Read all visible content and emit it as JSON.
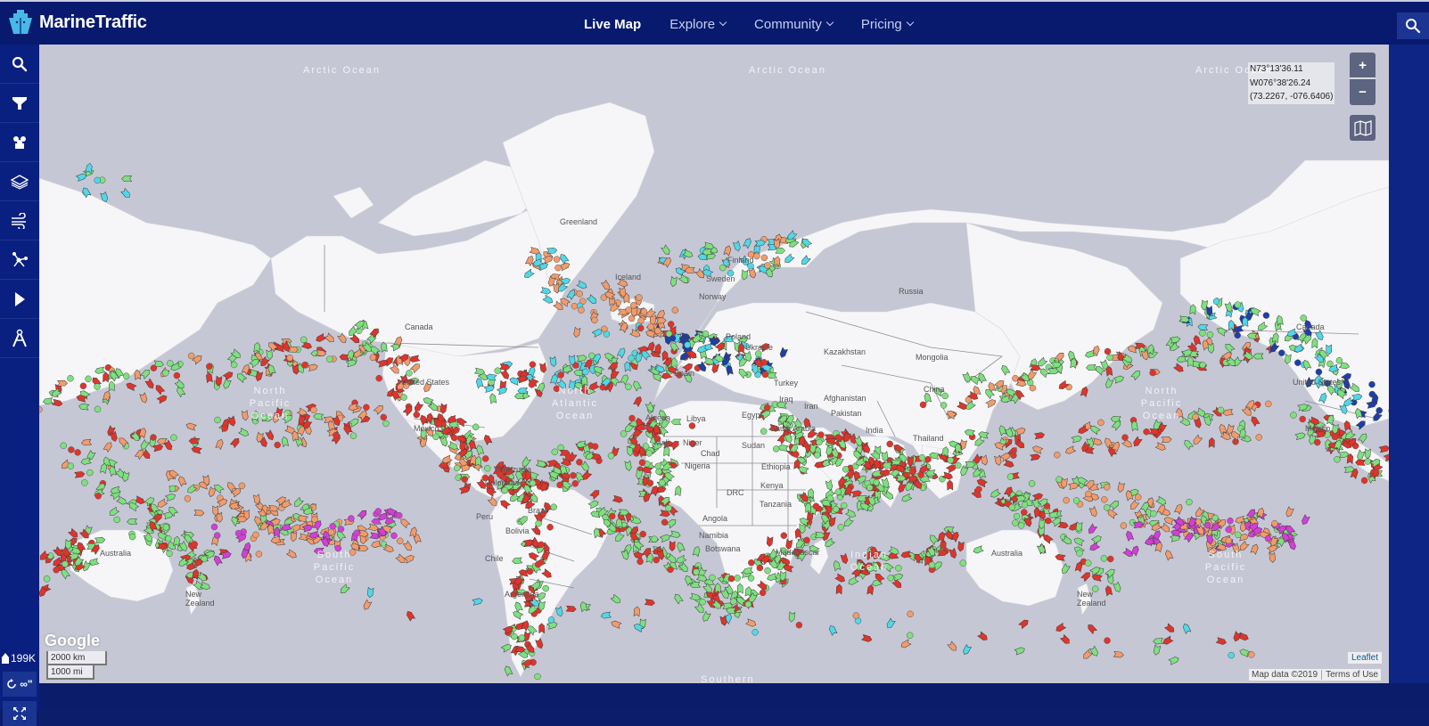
{
  "app": {
    "brand": "MarineTraffic",
    "logo_icon": "ship-bow-icon"
  },
  "nav": {
    "items": [
      {
        "label": "Live Map",
        "active": true,
        "dropdown": false
      },
      {
        "label": "Explore",
        "active": false,
        "dropdown": true
      },
      {
        "label": "Community",
        "active": false,
        "dropdown": true
      },
      {
        "label": "Pricing",
        "active": false,
        "dropdown": true
      }
    ],
    "search_icon": "search-icon"
  },
  "sidebar": {
    "items": [
      {
        "name": "search",
        "icon": "search-icon"
      },
      {
        "name": "filters",
        "icon": "filter-icon"
      },
      {
        "name": "fleets",
        "icon": "fleet-icon"
      },
      {
        "name": "layers",
        "icon": "layers-icon"
      },
      {
        "name": "weather",
        "icon": "wind-icon"
      },
      {
        "name": "density",
        "icon": "network-icon"
      },
      {
        "name": "playback",
        "icon": "play-icon"
      },
      {
        "name": "measure",
        "icon": "compass-icon"
      }
    ],
    "vessel_count": "199K",
    "loop_label": "∞\"",
    "fullscreen_icon": "fullscreen-icon"
  },
  "map": {
    "coordinates": {
      "lat_dms": "N73°13'36.11",
      "lon_dms": "W076°38'26.24",
      "decimal": "(73.2267, -076.6406)"
    },
    "zoom_in": "+",
    "zoom_out": "−",
    "ocean_labels": [
      {
        "text": "Arctic Ocean",
        "id": "arctic-1"
      },
      {
        "text": "Arctic Ocean",
        "id": "arctic-2"
      },
      {
        "text": "Arctic Ocean",
        "id": "arctic-3"
      },
      {
        "text": "North Pacific Ocean",
        "id": "npac-1"
      },
      {
        "text": "North Atlantic Ocean",
        "id": "natl"
      },
      {
        "text": "North Pacific Ocean",
        "id": "npac-2"
      },
      {
        "text": "South Pacific Ocean",
        "id": "spac-1"
      },
      {
        "text": "Indian Ocean",
        "id": "indian"
      },
      {
        "text": "South Pacific Ocean",
        "id": "spac-2"
      },
      {
        "text": "Southern",
        "id": "southern"
      }
    ],
    "country_labels": [
      "Greenland",
      "Iceland",
      "Canada",
      "United States",
      "Mexico",
      "Venezuela",
      "Colombia",
      "Brazil",
      "Bolivia",
      "Peru",
      "Chile",
      "Argentina",
      "Finland",
      "Sweden",
      "Norway",
      "Poland",
      "Ukraine",
      "Spain",
      "Turkey",
      "Russia",
      "Kazakhstan",
      "Mongolia",
      "China",
      "Iraq",
      "Iran",
      "Afghanistan",
      "Pakistan",
      "India",
      "Thailand",
      "Saudi Arabia",
      "Egypt",
      "Libya",
      "Algeria",
      "Mali",
      "Niger",
      "Chad",
      "Sudan",
      "Ethiopia",
      "Nigeria",
      "DRC",
      "Kenya",
      "Tanzania",
      "Angola",
      "Namibia",
      "Botswana",
      "Madagascar",
      "Australia",
      "New Zealand",
      "Canada",
      "United States",
      "Mexico",
      "Australia",
      "New Zealand"
    ],
    "google_logo": "Google",
    "scale_km": "2000 km",
    "scale_mi": "1000 mi",
    "leaflet_link": "Leaflet",
    "map_data": "Map data ©2019",
    "terms": "Terms of Use"
  },
  "vessel_colors": {
    "cargo": "#7ee07e",
    "tanker": "#e0342b",
    "passenger": "#2b7ee0",
    "fishing": "#f29b6b",
    "tug": "#4fd8e8",
    "pleasure": "#d53ed8",
    "highspeed": "#e8e04f",
    "navy": "#1e3ea8",
    "unknown": "#bbbbbb"
  }
}
